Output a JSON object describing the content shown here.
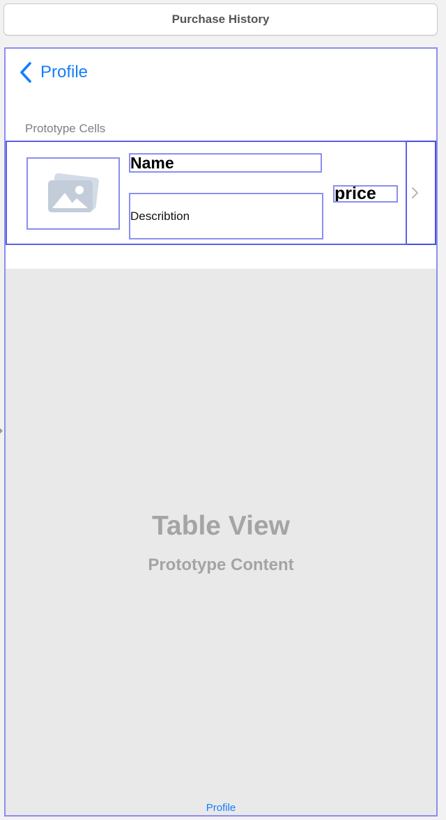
{
  "window": {
    "title": "Purchase History"
  },
  "navbar": {
    "back_label": "Profile"
  },
  "table": {
    "section_header": "Prototype Cells",
    "cell": {
      "name": "Name",
      "description": "Describtion",
      "price": "price"
    },
    "placeholder_title": "Table View",
    "placeholder_subtitle": "Prototype Content"
  },
  "footer": {
    "label": "Profile"
  },
  "colors": {
    "tint": "#147efb",
    "selection_outline": "#8a8ef0",
    "placeholder_text": "#a4a4a4",
    "table_background": "#e9e9e9"
  },
  "icons": {
    "back": "back-chevron-icon",
    "image": "image-placeholder-icon",
    "disclosure": "disclosure-chevron-icon"
  }
}
